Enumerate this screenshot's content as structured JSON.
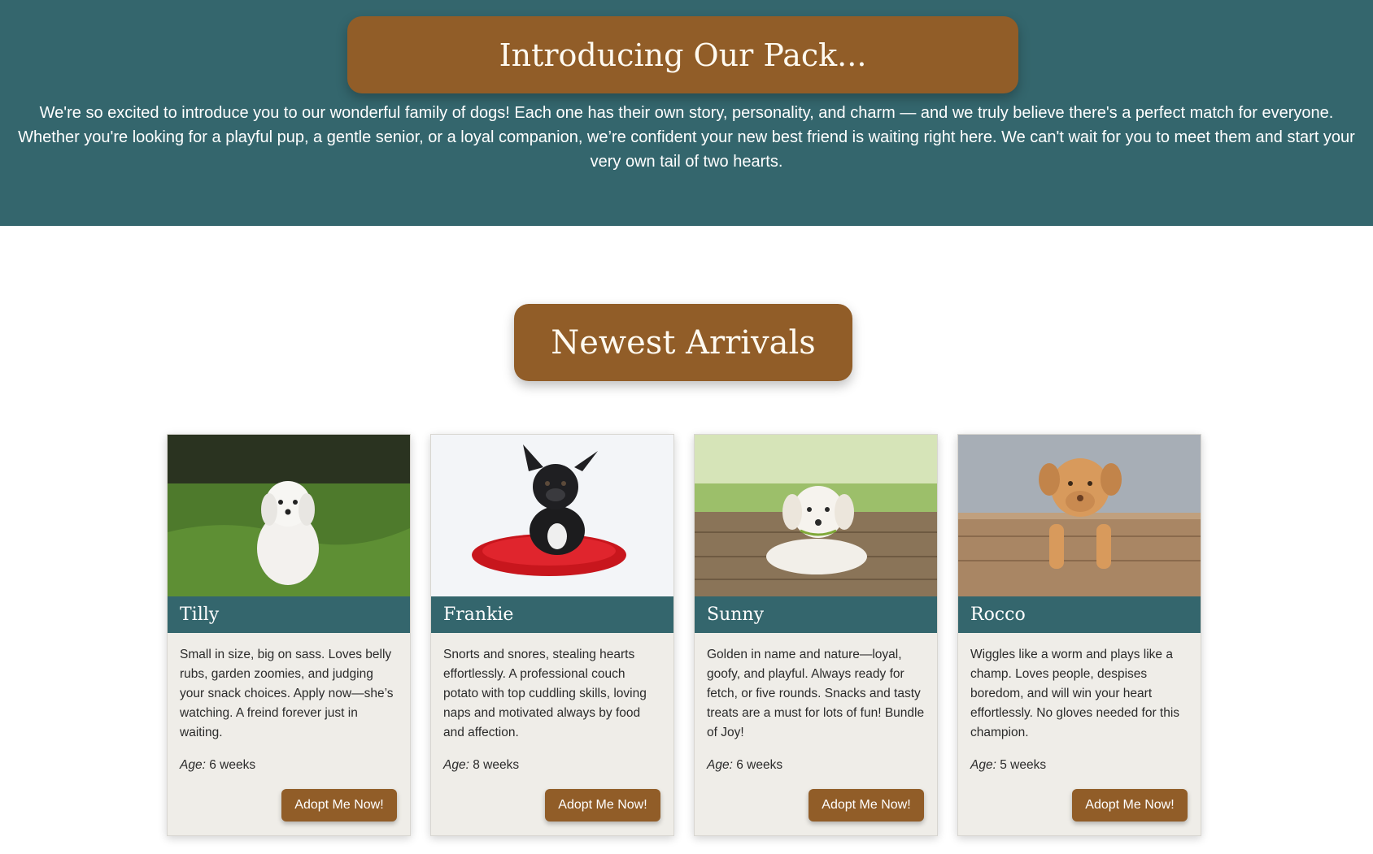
{
  "hero": {
    "title": "Introducing Our Pack...",
    "intro": "We're so excited to introduce you to our wonderful family of dogs! Each one has their own story, personality, and charm — and we truly believe there's a perfect match for everyone. Whether you're looking for a playful pup, a gentle senior, or a loyal companion, we’re confident your new best friend is waiting right here. We can't wait for you to meet them and start your very own tail of two hearts."
  },
  "section": {
    "title": "Newest Arrivals"
  },
  "age_label": "Age:",
  "dogs": [
    {
      "name": "Tilly",
      "description": "Small in size, big on sass. Loves belly rubs, garden zoomies, and judging your snack choices. Apply now—she’s watching. A freind forever just in waiting.",
      "age": "6 weeks",
      "button": "Adopt Me Now!",
      "photo": "white-maltese-puppy-on-grass"
    },
    {
      "name": "Frankie",
      "description": "Snorts and snores, stealing hearts effortlessly. A professional couch potato with top cuddling skills, loving naps and motivated always by food and affection.",
      "age": "8 weeks",
      "button": "Adopt Me Now!",
      "photo": "black-french-bulldog-on-red-cushion"
    },
    {
      "name": "Sunny",
      "description": "Golden in name and nature—loyal, goofy, and playful. Always ready for fetch, or five rounds. Snacks and tasty treats are a must for lots of fun! Bundle of Joy!",
      "age": "6 weeks",
      "button": "Adopt Me Now!",
      "photo": "white-labrador-puppy-on-wooden-deck"
    },
    {
      "name": "Rocco",
      "description": "Wiggles like a worm and plays like a champ. Loves people, despises boredom, and will win your heart effortlessly. No gloves needed for this champion.",
      "age": "5 weeks",
      "button": "Adopt Me Now!",
      "photo": "tan-mastiff-puppy-in-wooden-crate"
    }
  ]
}
